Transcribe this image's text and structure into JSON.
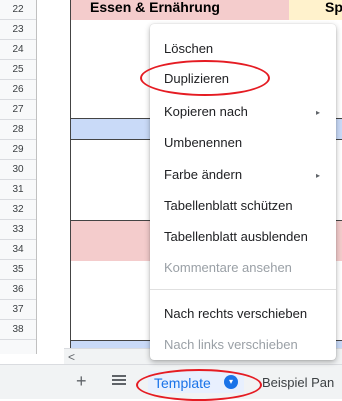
{
  "sheet": {
    "row_numbers": [
      "22",
      "23",
      "24",
      "25",
      "26",
      "27",
      "28",
      "29",
      "30",
      "31",
      "32",
      "33",
      "34",
      "35",
      "36",
      "37",
      "38"
    ],
    "column_headers": {
      "essen": "Essen & Ernährung",
      "sport": "Sport"
    }
  },
  "context_menu": {
    "items": [
      {
        "label": "Löschen",
        "enabled": true
      },
      {
        "label": "Duplizieren",
        "enabled": true,
        "highlighted": true
      },
      {
        "label": "Kopieren nach",
        "enabled": true,
        "submenu": true
      },
      {
        "label": "Umbenennen",
        "enabled": true
      },
      {
        "label": "Farbe ändern",
        "enabled": true,
        "submenu": true
      },
      {
        "label": "Tabellenblatt schützen",
        "enabled": true
      },
      {
        "label": "Tabellenblatt ausblenden",
        "enabled": true
      },
      {
        "label": "Kommentare ansehen",
        "enabled": false
      },
      {
        "label": "Nach rechts verschieben",
        "enabled": true
      },
      {
        "label": "Nach links verschieben",
        "enabled": false
      }
    ],
    "submenu_arrow": "▸"
  },
  "bottom_bar": {
    "add_sheet_symbol": "+",
    "active_tab": "Template",
    "dropdown_symbol": "▾",
    "next_tab": "Beispiel Pan",
    "scroll_left_symbol": "<"
  },
  "colors": {
    "annotation_red": "#e51c23",
    "active_tab_blue": "#1a73e8",
    "band_red": "#f4cccc",
    "band_blue": "#c9daf8",
    "band_yellow": "#fff2cc"
  }
}
